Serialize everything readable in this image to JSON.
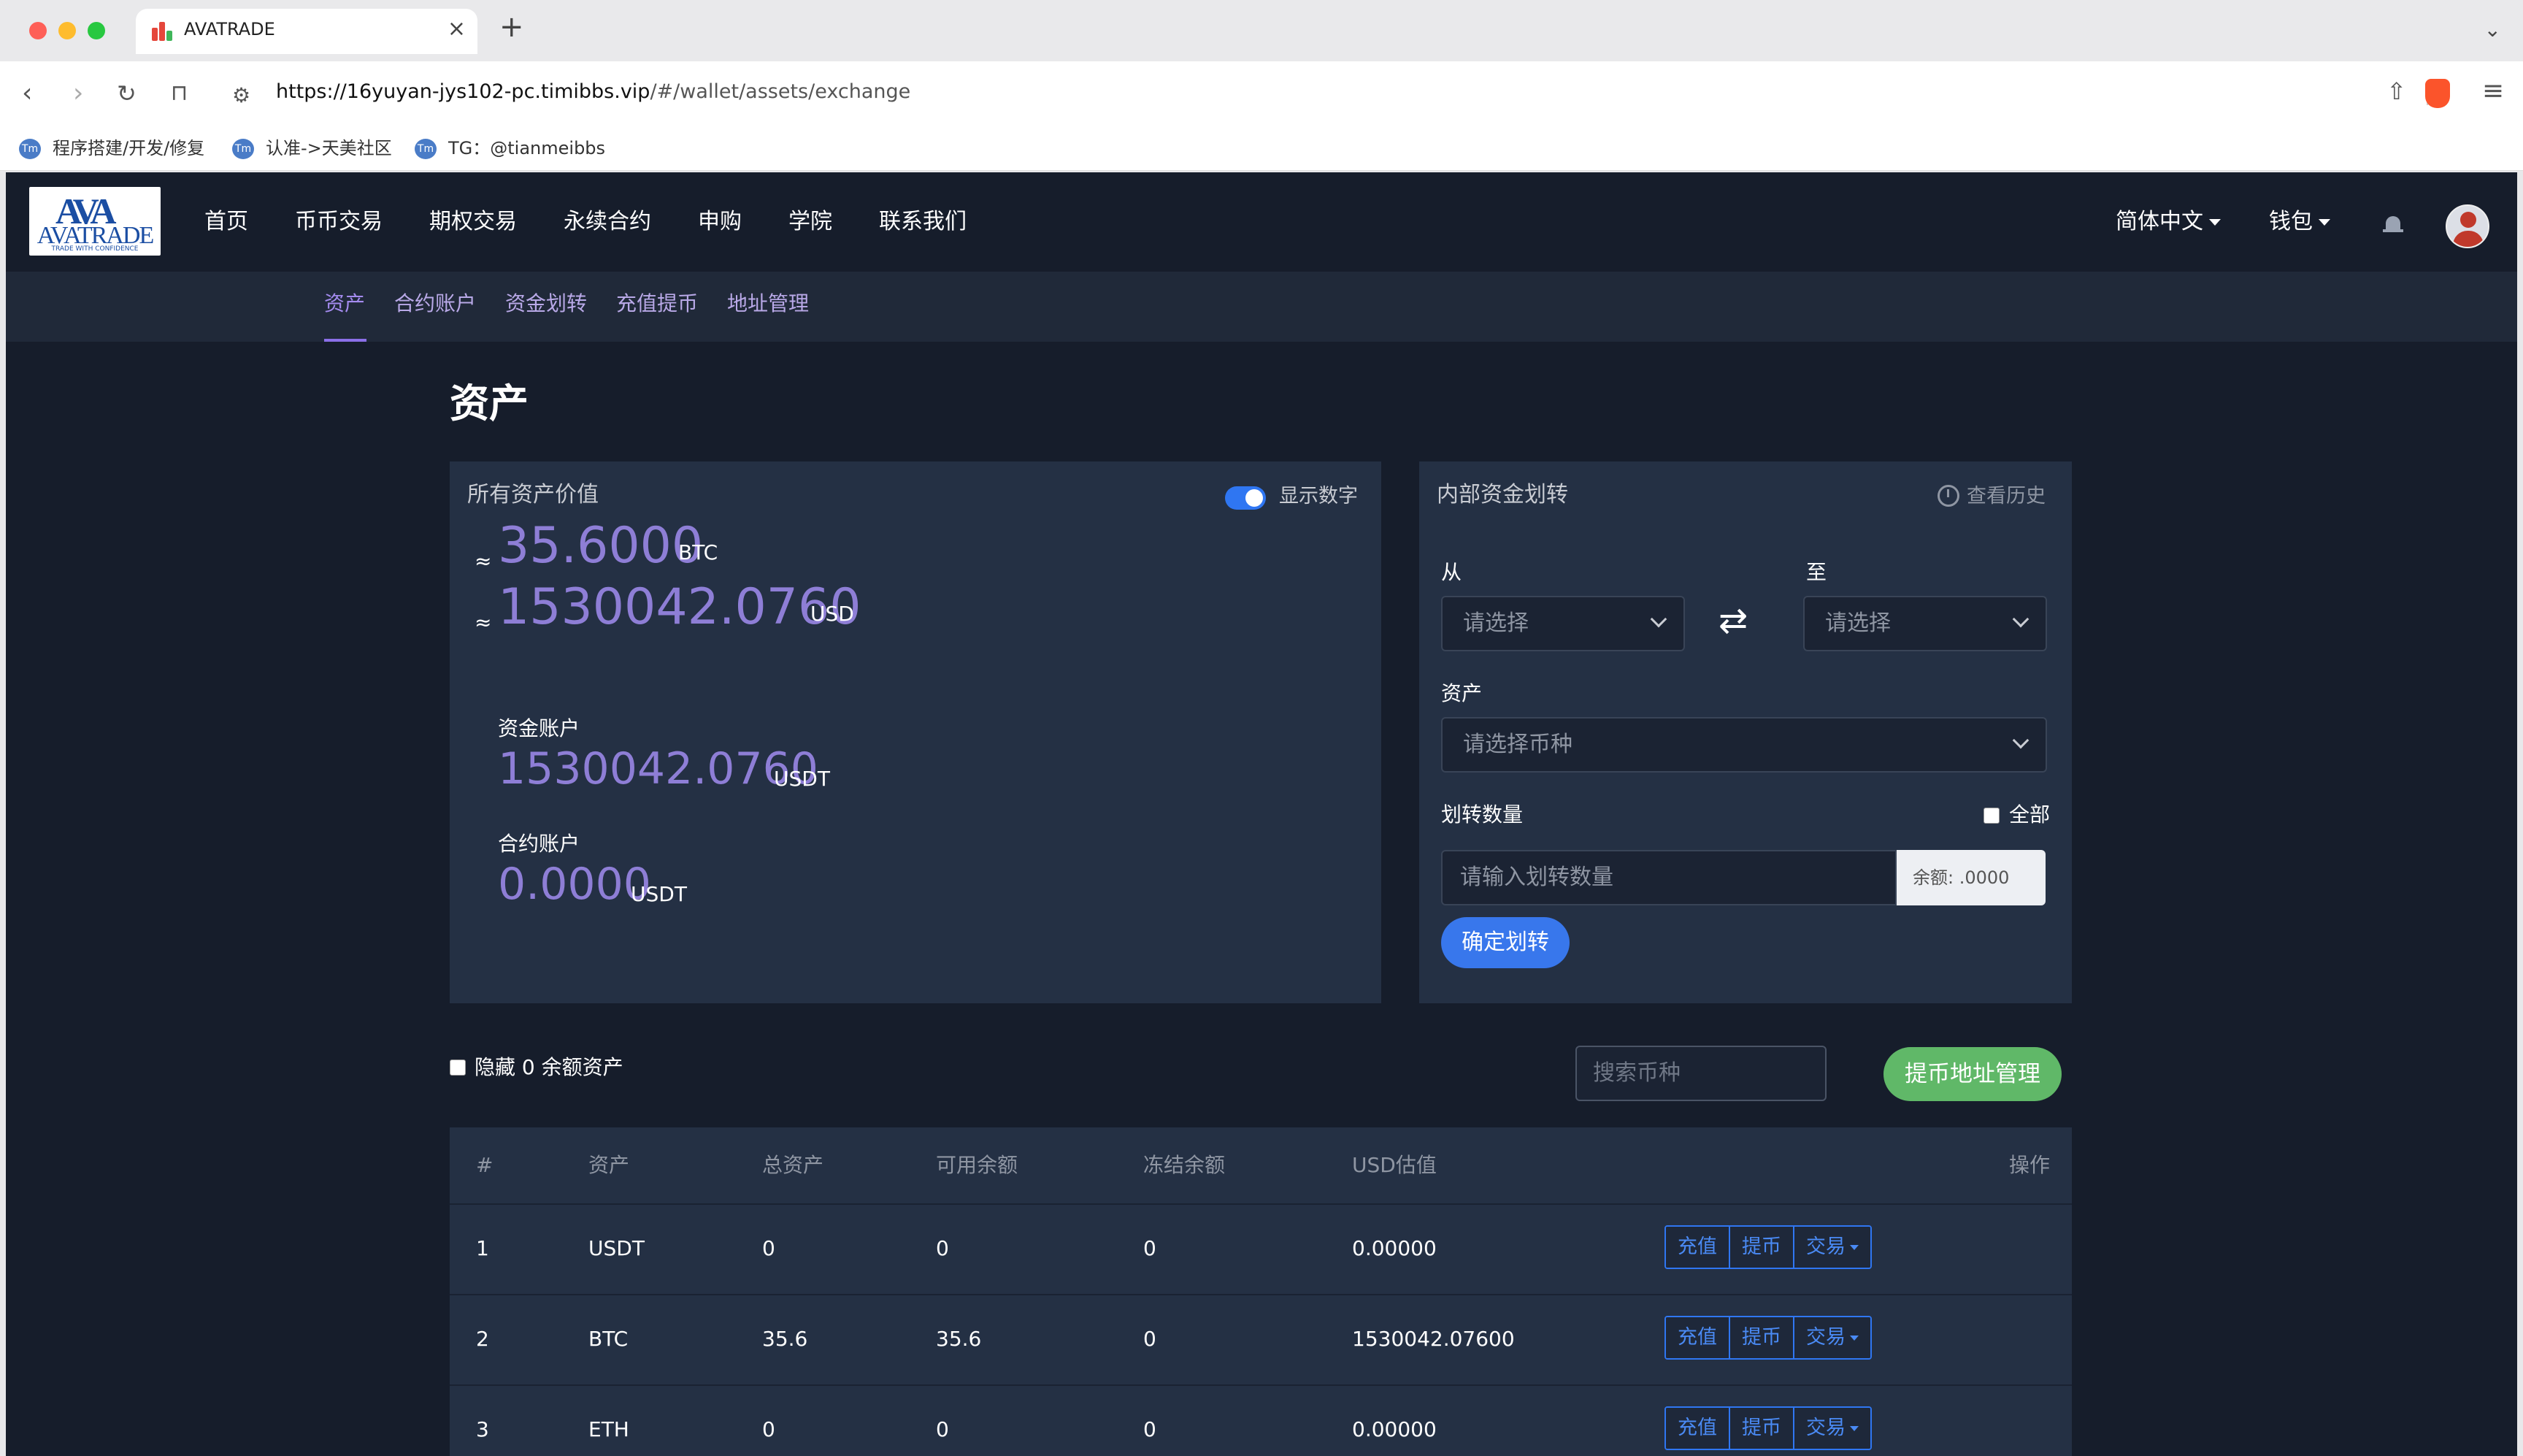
{
  "browser": {
    "tab_title": "AVATRADE",
    "tab_close": "×",
    "new_tab": "+",
    "url_host": "https://16yuyan-jys102-pc.timibbs.vip",
    "url_path": "/#/wallet/assets/exchange",
    "bookmarks": [
      "程序搭建/开发/修复",
      "认准->天美社区",
      "TG：@tianmeibbs"
    ]
  },
  "header": {
    "logo_mark": "AVA",
    "logo_word": "AVATRADE",
    "logo_tag": "TRADE WITH CONFIDENCE",
    "nav": [
      "首页",
      "币币交易",
      "期权交易",
      "永续合约",
      "申购",
      "学院",
      "联系我们"
    ],
    "language": "简体中文",
    "wallet": "钱包"
  },
  "subnav": {
    "items": [
      "资产",
      "合约账户",
      "资金划转",
      "充值提币",
      "地址管理"
    ],
    "active": "资产"
  },
  "page_title": "资产",
  "assets_card": {
    "title": "所有资产价值",
    "toggle_label": "显示数字",
    "toggle_on": true,
    "approx_symbol": "≈",
    "btc_value": "35.6000",
    "btc_unit": "BTC",
    "usd_value": "1530042.0760",
    "usd_unit": "USD",
    "fund_label": "资金账户",
    "fund_value": "1530042.0760",
    "fund_unit": "USDT",
    "contract_label": "合约账户",
    "contract_value": "0.0000",
    "contract_unit": "USDT"
  },
  "transfer_card": {
    "title": "内部资金划转",
    "history": "查看历史",
    "from_label": "从",
    "to_label": "至",
    "from_placeholder": "请选择",
    "to_placeholder": "请选择",
    "asset_label": "资产",
    "asset_placeholder": "请选择币种",
    "amount_label": "划转数量",
    "all_label": "全部",
    "amount_placeholder": "请输入划转数量",
    "balance": "余额: .0000",
    "confirm": "确定划转"
  },
  "list_controls": {
    "hide_zero": "隐藏 0 余额资产",
    "search_placeholder": "搜索币种",
    "address_button": "提币地址管理"
  },
  "table": {
    "headers": [
      "#",
      "资产",
      "总资产",
      "可用余额",
      "冻结余额",
      "USD估值",
      "操作"
    ],
    "rows": [
      {
        "idx": "1",
        "asset": "USDT",
        "total": "0",
        "available": "0",
        "frozen": "0",
        "usd": "0.00000"
      },
      {
        "idx": "2",
        "asset": "BTC",
        "total": "35.6",
        "available": "35.6",
        "frozen": "0",
        "usd": "1530042.07600"
      },
      {
        "idx": "3",
        "asset": "ETH",
        "total": "0",
        "available": "0",
        "frozen": "0",
        "usd": "0.00000"
      }
    ],
    "actions": {
      "deposit": "充值",
      "withdraw": "提币",
      "trade": "交易"
    }
  },
  "colors": {
    "page_bg": "#161d2b",
    "card_bg": "#243044",
    "accent_purple": "#8e7ed6",
    "primary_blue": "#2f76f2",
    "green_button": "#60b868"
  }
}
